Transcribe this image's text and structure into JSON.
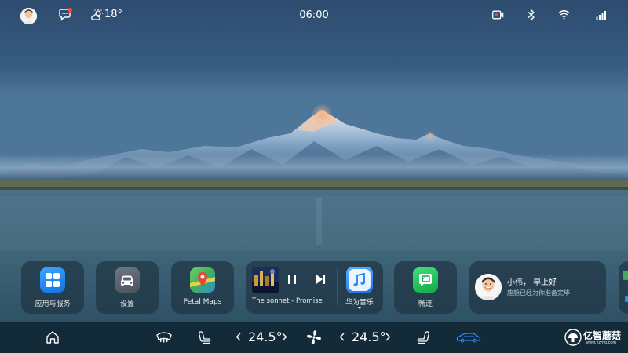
{
  "status_bar": {
    "avatar_icon": "user-avatar-icon",
    "message_icon": "message-bubble-icon",
    "weather_icon": "partly-cloudy-icon",
    "weather_temp": "18°",
    "clock": "06:00",
    "record_icon": "dashcam-record-icon",
    "bluetooth_icon": "bluetooth-icon",
    "wifi_icon": "wifi-icon",
    "signal_icon": "cellular-signal-icon",
    "notification_color": "#f24a3c"
  },
  "dock": {
    "apps": [
      {
        "label": "应用与服务",
        "icon": "apps-grid-icon",
        "color": "#1f8ef1"
      },
      {
        "label": "设置",
        "icon": "car-settings-icon",
        "color": "#5b6470"
      },
      {
        "label": "Petal Maps",
        "icon": "map-pin-icon",
        "color": "#3fae5c"
      }
    ],
    "music": {
      "song_title": "The sonnet - Promise",
      "app_label": "华为音乐",
      "app_icon": "music-note-icon",
      "app_color": "#2f8bf5",
      "pause_icon": "pause-icon",
      "next_icon": "skip-next-icon"
    },
    "connect": {
      "label": "畅连",
      "icon": "connect-screen-icon",
      "color": "#22c257"
    },
    "greeting": {
      "title": "小伟， 早上好",
      "subtitle": "座舱已经为你准备完毕",
      "avatar_icon": "user-avatar-icon"
    }
  },
  "control_bar": {
    "home_icon": "home-icon",
    "defrost_icon": "rear-defrost-icon",
    "seat_left_icon": "seat-heat-left-icon",
    "temp_left": "24.5°",
    "fan_icon": "fan-icon",
    "temp_right": "24.5°",
    "seat_right_icon": "seat-heat-right-icon",
    "car_icon": "car-status-icon",
    "car_icon_color": "#2f8bf5"
  },
  "watermark": {
    "text": "亿智蘑菇",
    "url": "www.yzmg.com"
  }
}
